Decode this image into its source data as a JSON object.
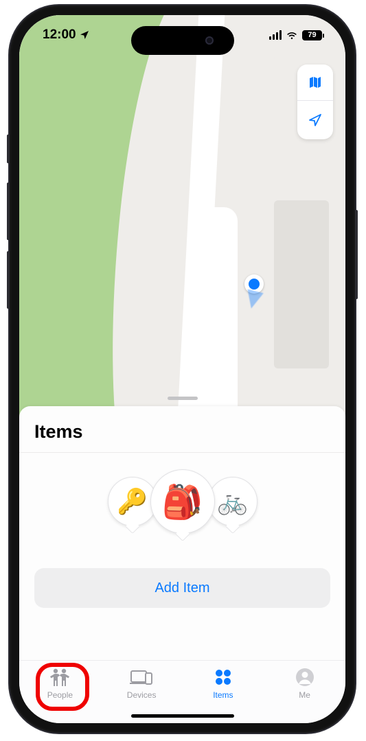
{
  "status": {
    "time": "12:00",
    "battery_pct": "79"
  },
  "map_controls": {
    "style": "map-style-icon",
    "locate": "location-arrow-icon"
  },
  "sheet": {
    "title": "Items",
    "suggestions": [
      {
        "emoji": "🔑",
        "name": "keys"
      },
      {
        "emoji": "🎒",
        "name": "backpack"
      },
      {
        "emoji": "🚲",
        "name": "bicycle"
      }
    ],
    "add_button_label": "Add Item"
  },
  "tabs": [
    {
      "id": "people",
      "label": "People",
      "active": false
    },
    {
      "id": "devices",
      "label": "Devices",
      "active": false
    },
    {
      "id": "items",
      "label": "Items",
      "active": true
    },
    {
      "id": "me",
      "label": "Me",
      "active": false
    }
  ],
  "annotation": {
    "highlighted_tab": "people"
  }
}
